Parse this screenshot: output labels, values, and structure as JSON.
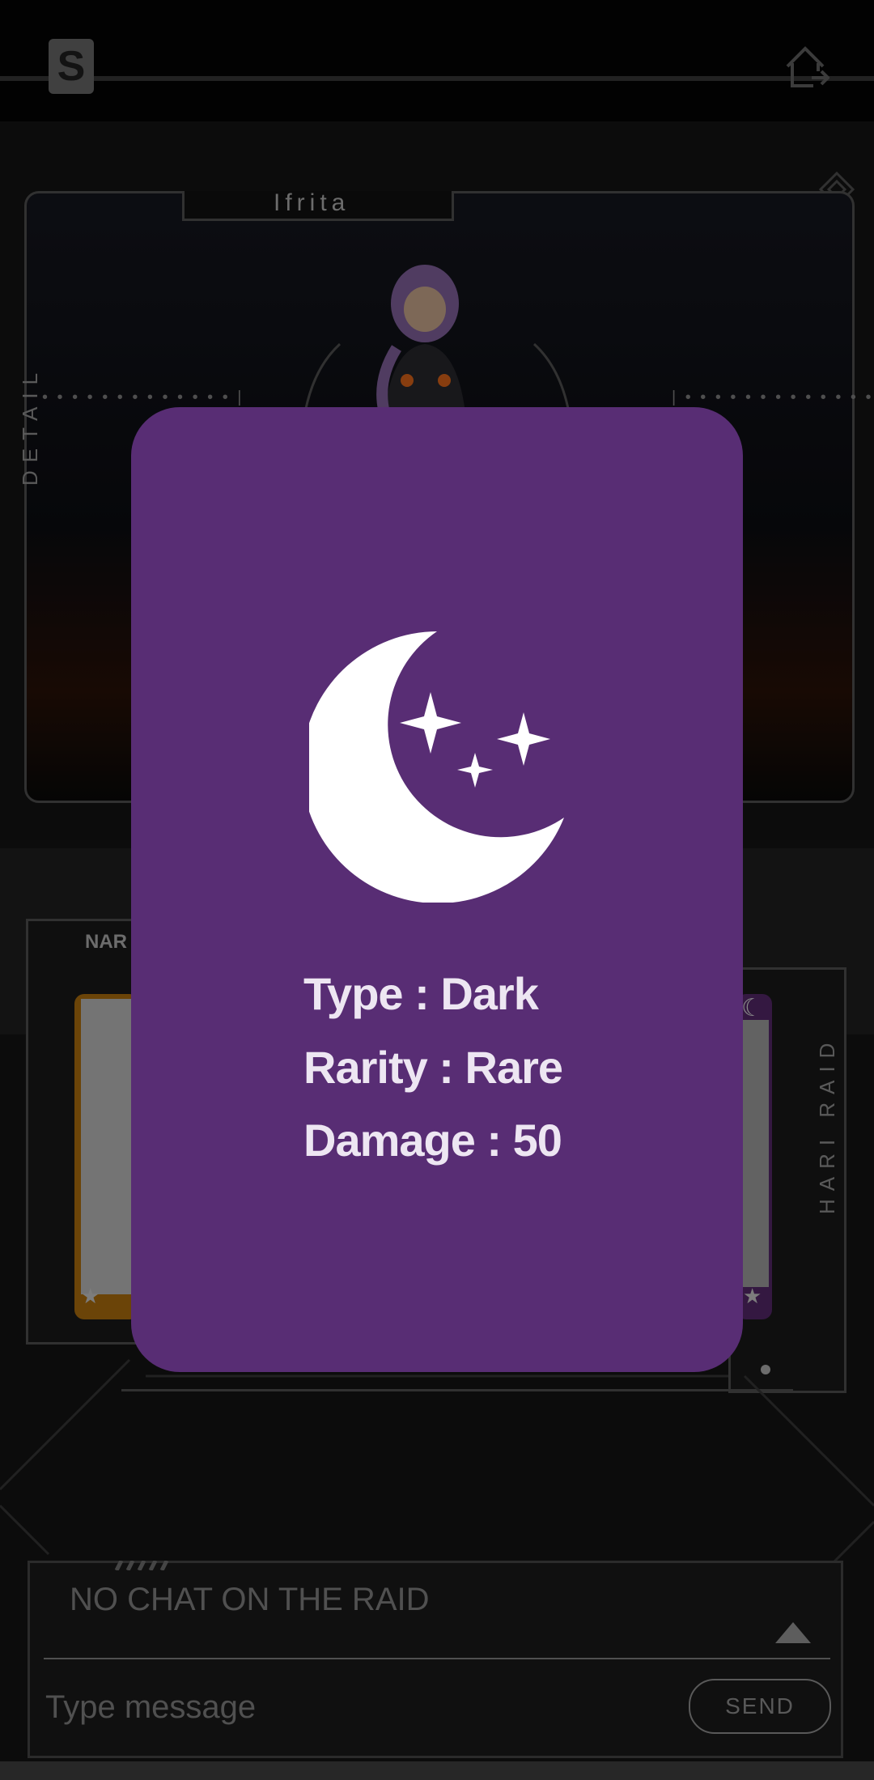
{
  "header": {
    "logo_letter": "S",
    "logo_icon": "s-logo",
    "home_icon": "home-icon",
    "corner_icon": "diamond-icon"
  },
  "detail": {
    "character_name": "Ifrita",
    "side_label": "DETAIL"
  },
  "raid": {
    "left_label": "NAR",
    "right_label": "HARI RAID"
  },
  "chat": {
    "status": "NO CHAT ON THE RAID",
    "input_placeholder": "Type message",
    "send_label": "SEND"
  },
  "popup": {
    "icon": "moon-stars-icon",
    "background_color": "#582d74",
    "type_text": "Type : Dark",
    "rarity_text": "Rarity : Rare",
    "damage_text": "Damage : 50"
  }
}
